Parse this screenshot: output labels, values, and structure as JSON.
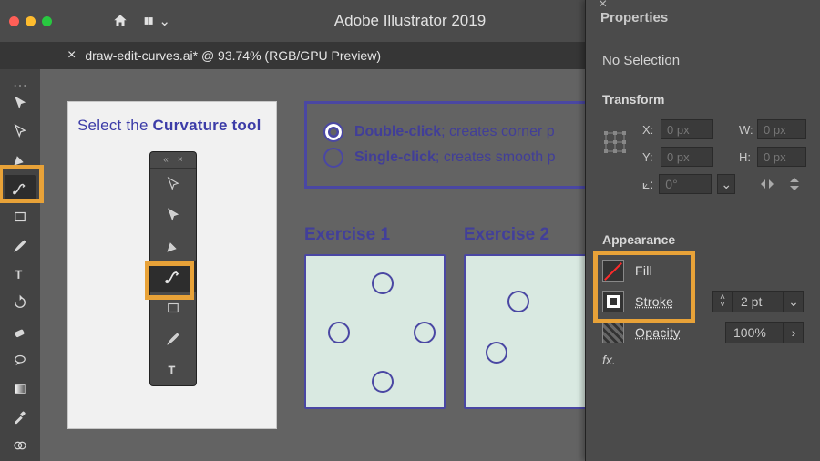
{
  "app": {
    "title": "Adobe Illustrator 2019",
    "tab_name": "draw-edit-curves.ai* @ 93.74% (RGB/GPU Preview)"
  },
  "highlights": {
    "curvature_tool_tooltip": "Curvature tool highlighted",
    "appearance_tooltip": "Appearance section highlighted"
  },
  "toolbar": {
    "tools": [
      {
        "name": "selection-tool"
      },
      {
        "name": "direct-selection-tool"
      },
      {
        "name": "pen-tool"
      },
      {
        "name": "curvature-tool",
        "active": true
      },
      {
        "name": "rectangle-tool"
      },
      {
        "name": "paintbrush-tool"
      },
      {
        "name": "type-tool"
      },
      {
        "name": "rotate-tool"
      },
      {
        "name": "eraser-tool"
      },
      {
        "name": "speech-tool"
      },
      {
        "name": "gradient-tool"
      },
      {
        "name": "eyedropper-tool"
      },
      {
        "name": "shape-builder-tool"
      }
    ]
  },
  "canvas": {
    "left_panel": {
      "title_prefix": "Select the ",
      "title_bold": "Curvature tool"
    },
    "legend": {
      "row1_bold": "Double-click",
      "row1_rest": "; creates corner p",
      "row2_bold": "Single-click",
      "row2_rest": "; creates smooth p"
    },
    "exercise1": "Exercise 1",
    "exercise2": "Exercise 2"
  },
  "properties": {
    "tab": "Properties",
    "selection_state": "No Selection",
    "transform_heading": "Transform",
    "x_label": "X:",
    "y_label": "Y:",
    "w_label": "W:",
    "h_label": "H:",
    "x_value": "0 px",
    "y_value": "0 px",
    "w_value": "0 px",
    "h_value": "0 px",
    "rot_icon_label": "⟀:",
    "rot_value": "0°",
    "appearance_heading": "Appearance",
    "fill_label": "Fill",
    "stroke_label": "Stroke",
    "stroke_value": "2 pt",
    "opacity_label": "Opacity",
    "opacity_value": "100%",
    "fx_label": "fx."
  }
}
